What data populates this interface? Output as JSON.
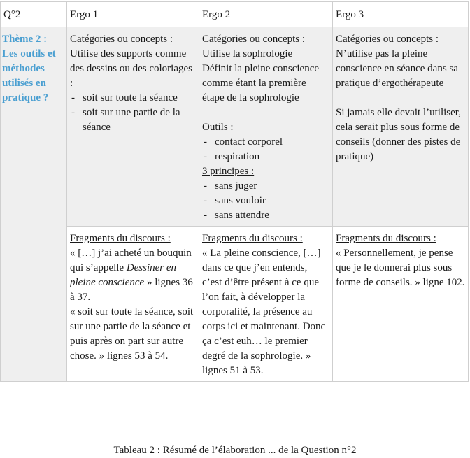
{
  "table": {
    "headers": [
      "Q°2",
      "Ergo 1",
      "Ergo 2",
      "Ergo 3"
    ],
    "theme": {
      "title": "Thème 2 :",
      "text": "Les outils et méthodes utilisés en pratique ?",
      "color": "#4a9fd1"
    },
    "categories_label": "Catégories ou concepts :",
    "fragments_label": "Fragments du discours :",
    "ergo1": {
      "concepts_text": "Utilise des supports comme des dessins ou des coloriages :",
      "concepts_bullets": [
        "soit sur toute la séance",
        "soit sur une partie de la séance"
      ],
      "fragment_1_pre": "« […] j’ai acheté un bouquin qui s’appelle ",
      "fragment_1_italic": "Dessiner en pleine conscience",
      "fragment_1_post": " » lignes 36 à 37.",
      "fragment_2": "« soit sur toute la séance, soit sur une partie de la séance et puis après on part sur autre chose. » lignes 53 à 54."
    },
    "ergo2": {
      "concepts_line_1": "Utilise la sophrologie",
      "concepts_line_2": "Définit la pleine conscience comme étant la première étape de la sophrologie",
      "tools_label": "Outils :",
      "tools": [
        "contact corporel",
        "respiration"
      ],
      "principles_label": "3 principes :",
      "principles": [
        "sans juger",
        "sans vouloir",
        "sans attendre"
      ],
      "fragment": "« La pleine conscience, […] dans ce que j’en entends, c’est d’être présent à ce que l’on fait, à développer la corporalité, la présence au corps ici et maintenant. Donc ça c’est euh… le premier degré de la sophrologie. » lignes 51 à 53."
    },
    "ergo3": {
      "concepts_para_1": "N’utilise pas la pleine conscience en séance dans sa pratique d’ergothérapeute",
      "concepts_para_2": "Si jamais elle devait l’utiliser, cela serait plus sous forme de conseils (donner des pistes de pratique)",
      "fragment": "« Personnellement, je pense que je le donnerai plus sous forme de conseils. » ligne 102."
    }
  },
  "caption": "Tableau 2 : Résumé de l’élaboration ... de la Question n°2"
}
